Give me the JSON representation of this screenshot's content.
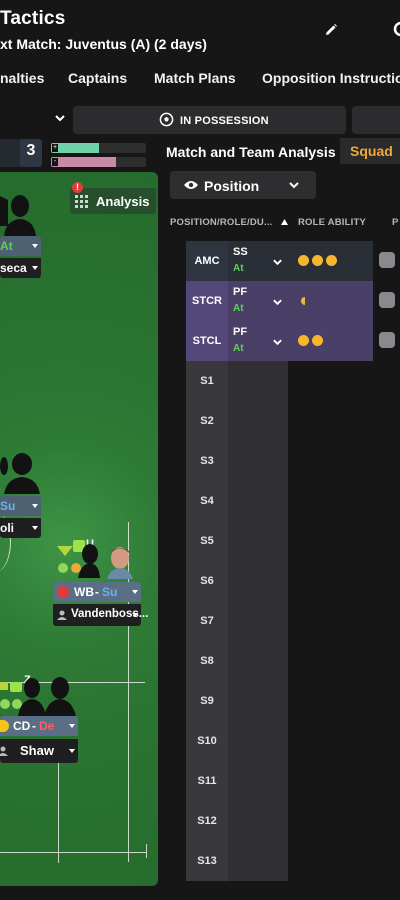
{
  "header": {
    "title": "Tactics",
    "subtitle": "xt Match: Juventus (A) (2 days)"
  },
  "tabs": [
    "nalties",
    "Captains",
    "Match Plans",
    "Opposition Instructio"
  ],
  "toolbar": {
    "in_possession_label": "IN POSSESSION"
  },
  "formation": {
    "player_count": "3",
    "familiarity_bars": [
      {
        "fill_percent": 50,
        "color": "#6fd2a8"
      },
      {
        "fill_percent": 68,
        "color": "#c98aa8"
      }
    ]
  },
  "pitch": {
    "analysis_label": "Analysis",
    "alert_icon": "!",
    "players": [
      {
        "role_label": "At",
        "role_color": "#5cd15c",
        "name": "seca"
      },
      {
        "role_label": "Su",
        "role_color": "#6ab0f0",
        "name": "oli"
      },
      {
        "role_abbrev": "WB",
        "duty": "Su",
        "duty_color": "#6ab0f0",
        "name": "Vandenboss..."
      },
      {
        "role_abbrev": "CD",
        "duty": "De",
        "duty_color": "#ff6060",
        "name": "Shaw"
      }
    ],
    "badges": [
      "U",
      "Z"
    ]
  },
  "panel": {
    "title": "Match and Team Analysis",
    "squad_tab": "Squad",
    "view_dropdown": "Position",
    "col_position": "POSITION/ROLE/DU...",
    "col_role_ability": "ROLE ABILITY",
    "col_partial": "P"
  },
  "rows": [
    {
      "pos": "AMC",
      "role": "SS",
      "duty": "At",
      "stars": 3
    },
    {
      "pos": "STCR",
      "role": "PF",
      "duty": "At",
      "stars": 0.5
    },
    {
      "pos": "STCL",
      "role": "PF",
      "duty": "At",
      "stars": 2
    }
  ],
  "subs": [
    "S1",
    "S2",
    "S3",
    "S4",
    "S5",
    "S6",
    "S7",
    "S8",
    "S9",
    "S10",
    "S11",
    "S12",
    "S13"
  ],
  "colors": {
    "accent_orange": "#f0a83c",
    "row_amc_bg": "#2a2f37",
    "row_striker_bg": "#4a3f66",
    "duty_attack": "#5cd15c",
    "star_gold": "#f5b731"
  }
}
